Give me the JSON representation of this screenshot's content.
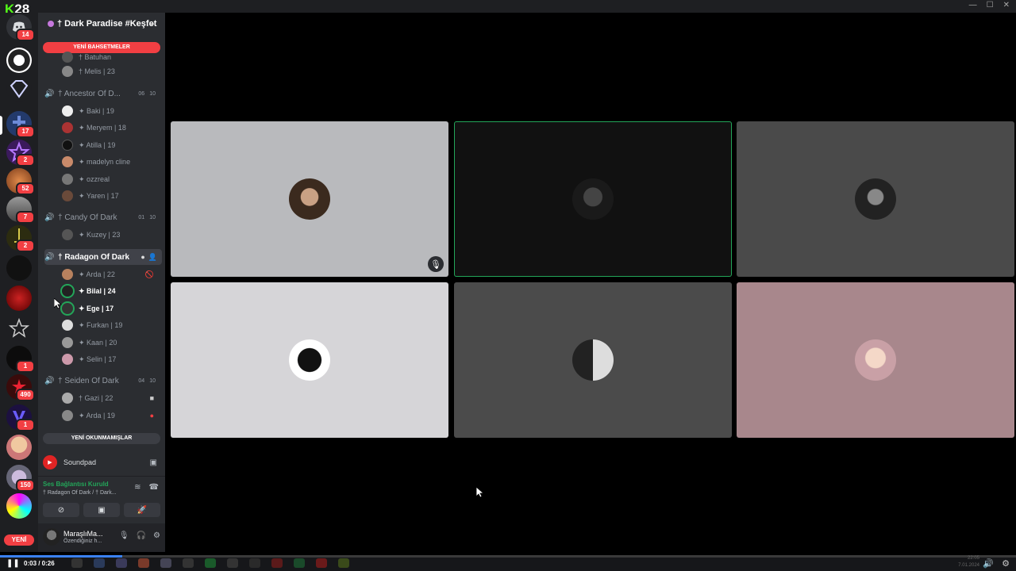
{
  "app": {
    "title": "Discord",
    "overlay_badge_prefix": "K",
    "overlay_badge_num": "28"
  },
  "rail": {
    "servers": [
      {
        "icon": "discord-home-icon",
        "badge": "14"
      },
      {
        "icon": "server-crown-icon",
        "badge": ""
      },
      {
        "icon": "server-diamond-icon",
        "badge": ""
      },
      {
        "icon": "server-cross-icon",
        "badge": "17"
      },
      {
        "icon": "server-star-icon",
        "badge": "2"
      },
      {
        "icon": "server-orange-icon",
        "badge": "52"
      },
      {
        "icon": "server-group-icon",
        "badge": "7"
      },
      {
        "icon": "server-sword-icon",
        "badge": "2"
      },
      {
        "icon": "server-dark-icon",
        "badge": ""
      },
      {
        "icon": "server-red-icon",
        "badge": ""
      },
      {
        "icon": "server-outline-star-icon",
        "badge": ""
      },
      {
        "icon": "server-black-icon",
        "badge": "1"
      },
      {
        "icon": "server-red-star-icon",
        "badge": "490"
      },
      {
        "icon": "server-v-icon",
        "badge": "1"
      },
      {
        "icon": "server-portrait-icon",
        "badge": ""
      },
      {
        "icon": "server-anime-icon",
        "badge": "150"
      },
      {
        "icon": "server-color-icon",
        "badge": ""
      }
    ],
    "new_label": "YENİ"
  },
  "sidebar": {
    "guild_name": "† Dark Paradise #Keşfet",
    "new_mentions": "YENİ BAHSETMELER",
    "new_unread": "YENİ OKUNMAMIŞLAR",
    "channels": [
      {
        "name": "† Ancestor Of D...",
        "c1": "06",
        "c2": "10",
        "members": [
          "✦ Baki | 19",
          "✦ Meryem | 18",
          "✦ Atilla | 19",
          "✦ madelyn cline",
          "✦ ozzreal",
          "✦ Yaren | 17"
        ]
      },
      {
        "name": "† Candy Of Dark",
        "c1": "01",
        "c2": "10",
        "members": [
          "✦ Kuzey | 23"
        ]
      },
      {
        "name": "† Radagon Of Dark",
        "c1": "",
        "c2": "",
        "members": [
          "✦ Arda | 22",
          "✦ Bilal | 24",
          "✦ Ege | 17",
          "✦ Furkan | 19",
          "✦ Kaan | 20",
          "✦ Selin | 17"
        ]
      },
      {
        "name": "† Seiden Of Dark",
        "c1": "04",
        "c2": "10",
        "members": [
          "† Gazi | 22",
          "✦ Arda | 19"
        ]
      }
    ],
    "partial_top": [
      "† Batuhan",
      "† Melis | 23"
    ],
    "soundpad": "Soundpad",
    "voice_status": "Ses Bağlantısı Kuruld",
    "voice_channel": "† Radagon Of Dark / † Dark...",
    "user_name": "MaraşlıMa...",
    "user_status": "Özendiğiniz h..."
  },
  "player": {
    "time": "0:03 / 0:26",
    "progress": 0.12,
    "clock_time": "22:05",
    "clock_date": "7.01.2024"
  },
  "colors": {
    "accent": "#5865f2",
    "speaking": "#23a559",
    "alert": "#f23f43"
  }
}
